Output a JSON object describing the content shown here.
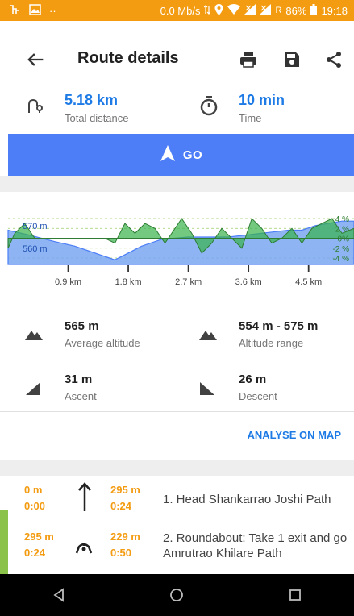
{
  "status_bar": {
    "network_speed": "0.0 Mb/s",
    "battery": "86%",
    "time": "19:18",
    "carrier_indicator": "R"
  },
  "toolbar": {
    "title": "Route details",
    "icons": [
      "back-arrow-icon",
      "print-icon",
      "save-icon",
      "share-icon"
    ]
  },
  "summary": {
    "distance_value": "5.18 km",
    "distance_label": "Total distance",
    "time_value": "10 min",
    "time_label": "Time"
  },
  "go_button": {
    "label": "GO"
  },
  "chart_data": {
    "type": "area",
    "title": "",
    "xlabel": "",
    "ylabel": "",
    "x_ticks": [
      "0.9 km",
      "1.8 km",
      "2.7 km",
      "3.6 km",
      "4.5 km"
    ],
    "x_tick_values_km": [
      0.9,
      1.8,
      2.7,
      3.6,
      4.5
    ],
    "xlim_km": [
      0,
      5.18
    ],
    "left_axis_labels": [
      "570 m",
      "560 m"
    ],
    "left_axis_values_m": [
      570,
      560
    ],
    "ylim_m": [
      553,
      577
    ],
    "right_axis_labels": [
      "4 %",
      "2 %",
      "0%",
      "-2 %",
      "-4 %"
    ],
    "right_axis_values_pct": [
      4,
      2,
      0,
      -2,
      -4
    ],
    "grid": "dashed horizontal",
    "series": [
      {
        "kind": "altitude",
        "color": "#4d7ef7",
        "x": [
          0,
          0.3,
          0.7,
          1.0,
          1.2,
          1.5,
          1.6,
          1.8,
          2.0,
          2.3,
          2.7,
          3.0,
          3.3,
          3.6,
          3.9,
          4.2,
          4.4,
          4.6,
          4.8,
          5.0,
          5.18
        ],
        "y": [
          568,
          566,
          563,
          561,
          559,
          556,
          555,
          558,
          561,
          564,
          565,
          565,
          565,
          566,
          567,
          568,
          568,
          570,
          571,
          572,
          572
        ]
      },
      {
        "kind": "slope",
        "color": "#38b24a",
        "x": [
          0,
          0.1,
          0.25,
          0.4,
          0.55,
          0.7,
          0.85,
          1.0,
          1.15,
          1.3,
          1.45,
          1.6,
          1.75,
          1.9,
          2.05,
          2.2,
          2.35,
          2.5,
          2.6,
          2.75,
          2.9,
          3.05,
          3.2,
          3.35,
          3.5,
          3.65,
          3.8,
          3.95,
          4.1,
          4.25,
          4.4,
          4.55,
          4.7,
          4.85,
          5.0,
          5.18
        ],
        "y": [
          -2,
          1,
          3,
          0,
          0,
          0,
          0,
          0,
          0,
          0,
          0,
          -1,
          3,
          1,
          3,
          2,
          -1,
          2,
          4,
          1,
          -3,
          -1,
          2,
          0,
          -2,
          4,
          2,
          -1,
          0,
          2,
          -1,
          2,
          3,
          4,
          1,
          2
        ]
      }
    ]
  },
  "metrics": {
    "avg_altitude_value": "565 m",
    "avg_altitude_label": "Average altitude",
    "altitude_range_value": "554 m - 575 m",
    "altitude_range_label": "Altitude range",
    "ascent_value": "31 m",
    "ascent_label": "Ascent",
    "descent_value": "26 m",
    "descent_label": "Descent"
  },
  "analyse_label": "ANALYSE ON MAP",
  "steps": [
    {
      "dist_start": "0 m",
      "time_start": "0:00",
      "dist_step": "295 m",
      "time_step": "0:24",
      "instruction": "1. Head Shankarrao Joshi Path",
      "icon": "straight-arrow-icon"
    },
    {
      "dist_start": "295 m",
      "time_start": "0:24",
      "dist_step": "229 m",
      "time_step": "0:50",
      "instruction": "2. Roundabout: Take 1 exit and go Amrutrao Khilare Path",
      "icon": "roundabout-icon"
    }
  ],
  "colors": {
    "status_bar": "#f39c12",
    "accent": "#4d7ef7",
    "link": "#1e7be6",
    "step_numbers": "#f39c12",
    "slope": "#38b24a"
  }
}
